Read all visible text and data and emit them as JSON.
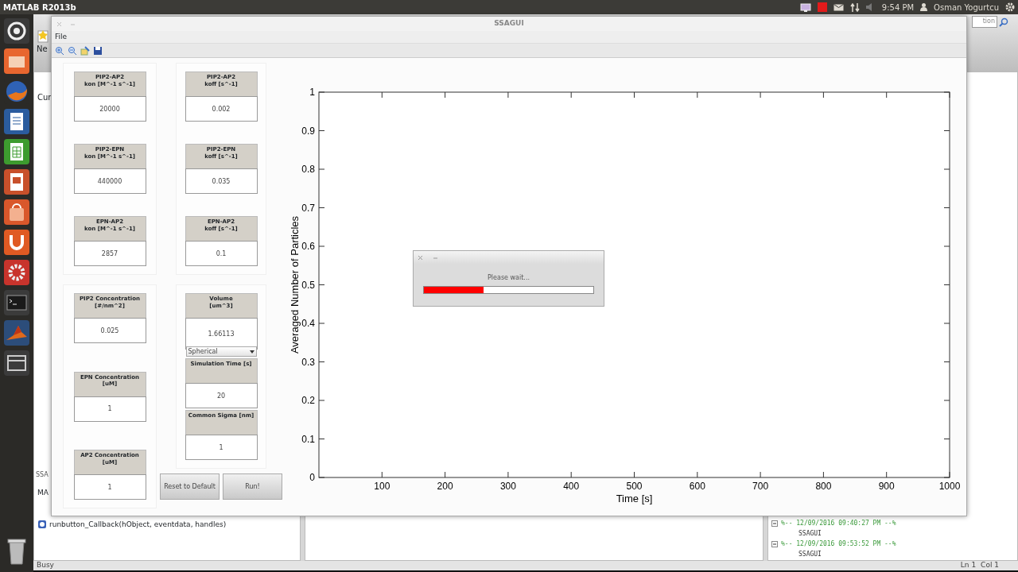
{
  "top_panel": {
    "app_title": "MATLAB R2013b",
    "clock": "9:54 PM",
    "user": "Osman Yogurtcu"
  },
  "matlab": {
    "toolbar_label": "Ne",
    "search_text": "tion",
    "folder_heading": "Cur",
    "editor_tab": "SSA",
    "function_heading": "MA",
    "functions": [
      "runbutton_Callback(hObject, eventdata, handles)"
    ],
    "status": "Busy",
    "history": [
      {
        "label": "%-- 12/09/2016 09:40:27 PM --%",
        "expanded": true,
        "children": [
          {
            "label": "SSAGUI"
          }
        ]
      },
      {
        "label": "%-- 12/09/2016 09:53:52 PM --%",
        "expanded": true,
        "children": [
          {
            "label": "SSAGUI"
          }
        ]
      }
    ],
    "cursor_line": "Ln  1",
    "cursor_col": "Col  1"
  },
  "figure": {
    "title": "SSAGUI",
    "menu": [
      "File"
    ],
    "parameter_panels": [
      {
        "items": [
          {
            "kind": "field",
            "label": "PIP2-AP2\nkon [M^-1 s^-1]",
            "value": "20000"
          },
          {
            "kind": "field",
            "label": "PIP2-EPN\nkon [M^-1 s^-1]",
            "value": "440000"
          },
          {
            "kind": "field",
            "label": "EPN-AP2\nkon [M^-1 s^-1]",
            "value": "2857"
          }
        ]
      },
      {
        "items": [
          {
            "kind": "field",
            "label": "PIP2-AP2\nkoff [s^-1]",
            "value": "0.002"
          },
          {
            "kind": "field",
            "label": "PIP2-EPN\nkoff [s^-1]",
            "value": "0.035"
          },
          {
            "kind": "field",
            "label": "EPN-AP2\nkoff [s^-1]",
            "value": "0.1"
          }
        ]
      },
      {
        "items": [
          {
            "kind": "field",
            "label": "PIP2 Concentration\n[#/nm^2]",
            "value": "0.025"
          },
          {
            "kind": "field",
            "label": "EPN Concentration\n[uM]",
            "value": "1"
          },
          {
            "kind": "field",
            "label": "AP2 Concentration\n[uM]",
            "value": "1"
          }
        ]
      },
      {
        "items": [
          {
            "kind": "field",
            "label": "Volume\n[um^3]",
            "value": "1.66113"
          },
          {
            "kind": "dropdown",
            "value": "Spherical"
          },
          {
            "kind": "field",
            "label": "Simulation Time [s]",
            "value": "20"
          },
          {
            "kind": "field",
            "label": "Common Sigma [nm]",
            "value": "1"
          }
        ]
      }
    ],
    "buttons": [
      "Reset to Default",
      "Run!"
    ],
    "chart_data": {
      "type": "line",
      "xlabel": "Time [s]",
      "ylabel": "Averaged Number of Particles",
      "xlim": [
        0,
        1000
      ],
      "ylim": [
        0,
        1
      ],
      "xticks": [
        100,
        200,
        300,
        400,
        500,
        600,
        700,
        800,
        900,
        1000
      ],
      "yticks": [
        0,
        0.1,
        0.2,
        0.3,
        0.4,
        0.5,
        0.6,
        0.7,
        0.8,
        0.9,
        1
      ]
    }
  },
  "progress_dialog": {
    "message": "Please wait...",
    "level": 0.35
  }
}
